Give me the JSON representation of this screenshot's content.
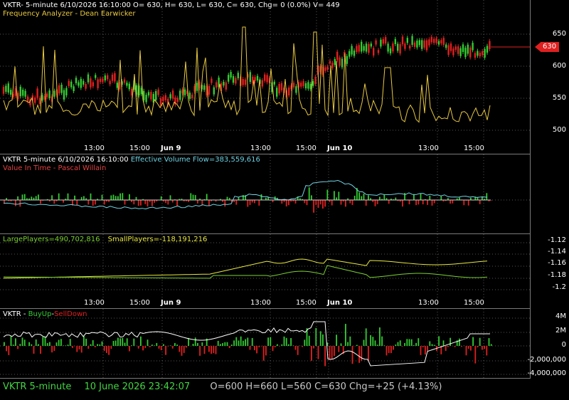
{
  "panel1": {
    "title": "VKTR- 5-minute 6/10/2026 16:10:00 O= 630, H= 630, L= 630, C= 630, Chg= 0 (0.0%) V= 449",
    "subtitle": "Frequency Analyzer - Dean Earwicker",
    "y_labels": [
      "650",
      "600",
      "550",
      "500"
    ],
    "price_badge": "630"
  },
  "time_axis": [
    "13:00",
    "15:00",
    "Jun 9",
    "13:00",
    "15:00",
    "Jun 10",
    "13:00",
    "15:00"
  ],
  "panel2": {
    "title_prefix": "VKTR 5-minute  6/10/2026 16:10:00",
    "title_indicator": "Effective Volume Flow=383,559,616",
    "subtitle": "Value In Time - Pascal Willain"
  },
  "panel3": {
    "large": "LargePlayers=490,702,816",
    "small": "SmallPlayers=-118,191,216",
    "y_labels": [
      "-1.12",
      "-1.14",
      "-1.16",
      "-1.18",
      "-1.2"
    ]
  },
  "panel4": {
    "prefix": "VKTR -",
    "buyup": "BuyUp",
    "dash": "-",
    "selldown": "SellDown",
    "y_labels": [
      "4M",
      "2M",
      "0",
      "-2,000,000",
      "-4,000,000"
    ]
  },
  "status": {
    "symbol": "VKTR  5-minute",
    "date": "10 June 2026 23:42:07",
    "ohlc": "O=600  H=660  L=560  C=630  Chg=+25 (+4.13%)"
  },
  "colors": {
    "up": "#33cc33",
    "down": "#e02020",
    "yellow": "#e8c840",
    "cyan": "#6fd0e0",
    "green_line": "#7ad030",
    "badge": "#e02020"
  }
}
